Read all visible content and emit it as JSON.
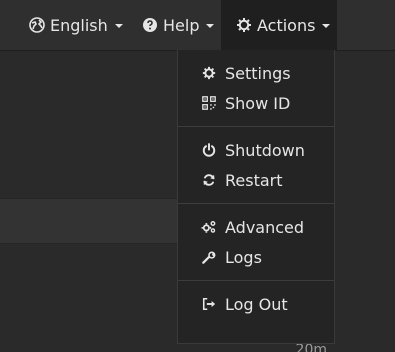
{
  "navbar": {
    "english": {
      "label": "English",
      "icon": "globe-icon"
    },
    "help": {
      "label": "Help",
      "icon": "help-icon"
    },
    "actions": {
      "label": "Actions",
      "icon": "gear-icon"
    }
  },
  "actions_menu": {
    "groups": [
      {
        "items": [
          {
            "label": "Settings",
            "icon": "gear-icon"
          },
          {
            "label": "Show ID",
            "icon": "qrcode-icon"
          }
        ]
      },
      {
        "items": [
          {
            "label": "Shutdown",
            "icon": "power-icon"
          },
          {
            "label": "Restart",
            "icon": "refresh-icon"
          }
        ]
      },
      {
        "items": [
          {
            "label": "Advanced",
            "icon": "gears-icon"
          },
          {
            "label": "Logs",
            "icon": "wrench-icon"
          }
        ]
      },
      {
        "items": [
          {
            "label": "Log Out",
            "icon": "sign-out-icon"
          }
        ]
      }
    ]
  },
  "background": {
    "peek_text": "20m"
  }
}
